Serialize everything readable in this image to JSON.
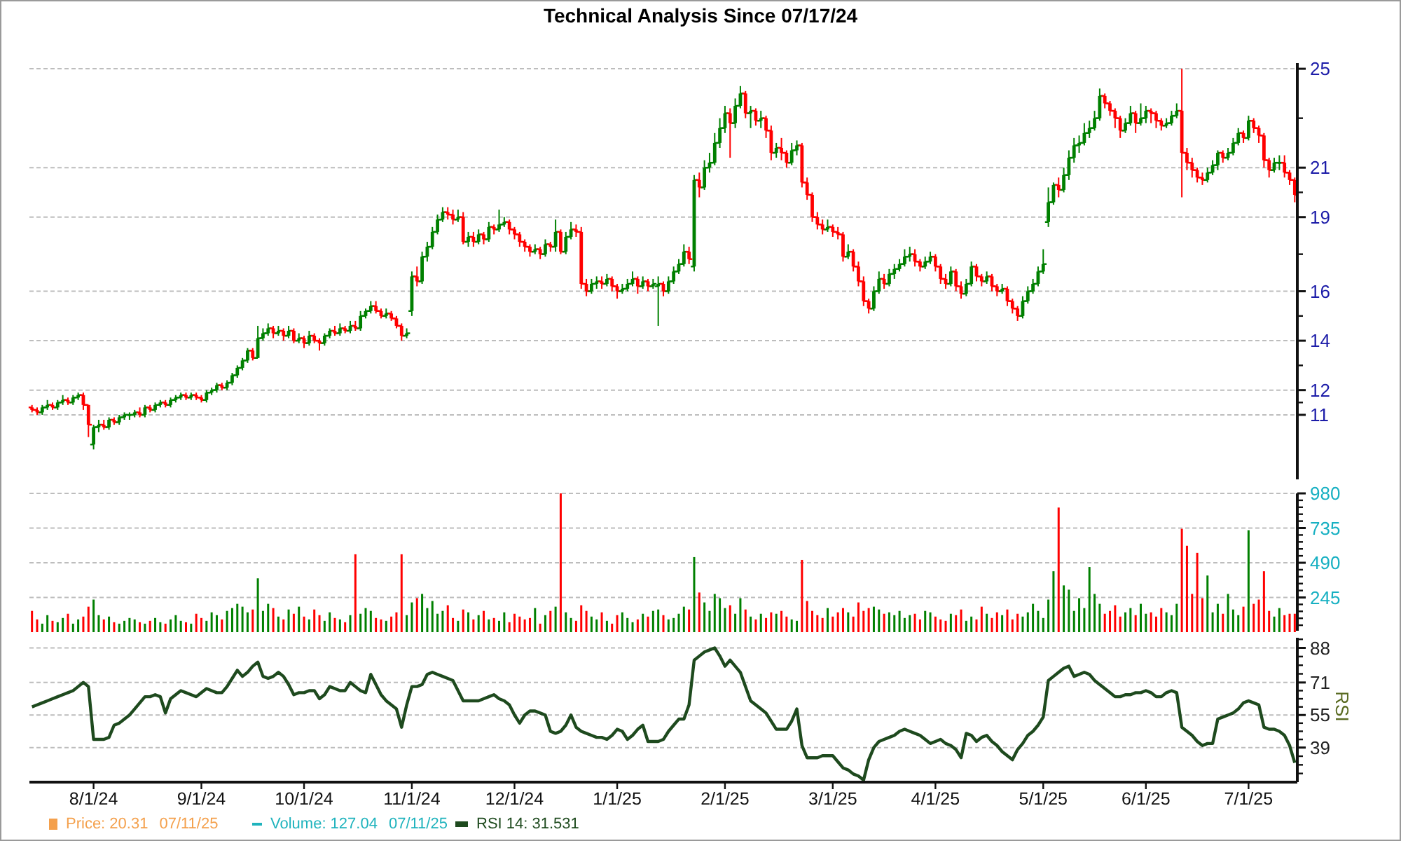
{
  "title": "Technical Analysis Since 07/17/24",
  "price_panel": {
    "chart_data": {
      "type": "candlestick",
      "grid": true,
      "ylim": [
        8.39,
        25.23
      ],
      "yticks": [
        25,
        21,
        19,
        16,
        14,
        12,
        11
      ],
      "categories": [
        null,
        null,
        null,
        null,
        null,
        null,
        null,
        null,
        null,
        null,
        null,
        null,
        null,
        null,
        null,
        null,
        null,
        null,
        null,
        null,
        null,
        null,
        null,
        null,
        null,
        null,
        null,
        null,
        null,
        null,
        null,
        null,
        null,
        null,
        null,
        null,
        null,
        null,
        null,
        null,
        null,
        null,
        null,
        null,
        null,
        null,
        null,
        null,
        null,
        null,
        null,
        null,
        null,
        null,
        null,
        null,
        null,
        null,
        null,
        null,
        null,
        null,
        null,
        null,
        null,
        null,
        null,
        null,
        null,
        null,
        null,
        null,
        null,
        null,
        null,
        null,
        null,
        null,
        null,
        null,
        null,
        null,
        null,
        null,
        null,
        null,
        null,
        null,
        null,
        null,
        null,
        null,
        null,
        null,
        null,
        null,
        null,
        null,
        null,
        null,
        null,
        null,
        null,
        null,
        null,
        null,
        null,
        null,
        null,
        null,
        null,
        null,
        null,
        null,
        null,
        null,
        null,
        null,
        null,
        null,
        null,
        null,
        null,
        null,
        null,
        null,
        null,
        null,
        null,
        null,
        null,
        null,
        null,
        null,
        null,
        null,
        null,
        null,
        null,
        null,
        null,
        null,
        null,
        null,
        null,
        null,
        null,
        null,
        null,
        null,
        null,
        null,
        null,
        null,
        null,
        null,
        null,
        null,
        null,
        null,
        null,
        null,
        null,
        null,
        null,
        null,
        null,
        null,
        null,
        null,
        null,
        null,
        null,
        null,
        null,
        null,
        null,
        null,
        null,
        null,
        null,
        null,
        null,
        null,
        null,
        null,
        null,
        null,
        null,
        null,
        null,
        null,
        null,
        null,
        null,
        null,
        null,
        null,
        null,
        null,
        null,
        null,
        null,
        null,
        null,
        null,
        null,
        null,
        null,
        null,
        null,
        null,
        null,
        null,
        null,
        null,
        null,
        null,
        null,
        null,
        null,
        null,
        null,
        null,
        null,
        null,
        null,
        null,
        null,
        null,
        null,
        null,
        null,
        null,
        null,
        null,
        null,
        null,
        null,
        null,
        null,
        null,
        null,
        null,
        null,
        null,
        null
      ],
      "ohlc": [
        [
          11.3,
          11.4,
          11.1,
          11.2
        ],
        [
          11.2,
          11.3,
          11.0,
          11.1
        ],
        [
          11.1,
          11.4,
          11.0,
          11.3
        ],
        [
          11.3,
          11.6,
          11.2,
          11.4
        ],
        [
          11.4,
          11.5,
          11.2,
          11.3
        ],
        [
          11.3,
          11.6,
          11.2,
          11.5
        ],
        [
          11.5,
          11.8,
          11.4,
          11.6
        ],
        [
          11.6,
          11.7,
          11.4,
          11.5
        ],
        [
          11.5,
          11.8,
          11.4,
          11.7
        ],
        [
          11.7,
          11.9,
          11.6,
          11.8
        ],
        [
          11.8,
          11.9,
          11.2,
          11.4
        ],
        [
          11.4,
          11.4,
          10.1,
          10.6
        ],
        [
          9.8,
          10.6,
          9.6,
          10.5
        ],
        [
          10.5,
          10.8,
          10.3,
          10.6
        ],
        [
          10.6,
          10.8,
          10.4,
          10.5
        ],
        [
          10.5,
          10.9,
          10.4,
          10.8
        ],
        [
          10.8,
          10.9,
          10.6,
          10.7
        ],
        [
          10.7,
          11.0,
          10.6,
          10.9
        ],
        [
          10.9,
          11.1,
          10.8,
          11.0
        ],
        [
          11.0,
          11.1,
          10.8,
          11.0
        ],
        [
          11.0,
          11.2,
          10.9,
          11.1
        ],
        [
          11.1,
          11.3,
          10.9,
          11.0
        ],
        [
          11.0,
          11.4,
          10.9,
          11.3
        ],
        [
          11.3,
          11.4,
          11.1,
          11.2
        ],
        [
          11.2,
          11.5,
          11.1,
          11.4
        ],
        [
          11.4,
          11.6,
          11.3,
          11.5
        ],
        [
          11.5,
          11.6,
          11.3,
          11.4
        ],
        [
          11.4,
          11.7,
          11.3,
          11.6
        ],
        [
          11.6,
          11.8,
          11.5,
          11.7
        ],
        [
          11.7,
          11.9,
          11.6,
          11.8
        ],
        [
          11.8,
          11.9,
          11.6,
          11.7
        ],
        [
          11.7,
          11.9,
          11.6,
          11.8
        ],
        [
          11.8,
          11.9,
          11.6,
          11.7
        ],
        [
          11.7,
          11.8,
          11.5,
          11.6
        ],
        [
          11.6,
          12.0,
          11.5,
          11.9
        ],
        [
          11.9,
          12.1,
          11.8,
          12.0
        ],
        [
          12.0,
          12.3,
          11.9,
          12.2
        ],
        [
          12.2,
          12.3,
          12.0,
          12.1
        ],
        [
          12.1,
          12.4,
          12.0,
          12.3
        ],
        [
          12.3,
          12.7,
          12.2,
          12.6
        ],
        [
          12.6,
          13.0,
          12.5,
          12.9
        ],
        [
          12.9,
          13.3,
          12.8,
          13.2
        ],
        [
          13.2,
          13.7,
          13.1,
          13.6
        ],
        [
          13.6,
          13.7,
          13.2,
          13.3
        ],
        [
          13.3,
          14.6,
          13.3,
          14.1
        ],
        [
          14.1,
          14.5,
          14.0,
          14.3
        ],
        [
          14.3,
          14.7,
          14.2,
          14.5
        ],
        [
          14.5,
          14.6,
          14.1,
          14.3
        ],
        [
          14.3,
          14.6,
          14.2,
          14.4
        ],
        [
          14.4,
          14.5,
          14.0,
          14.2
        ],
        [
          14.2,
          14.6,
          14.1,
          14.4
        ],
        [
          14.4,
          14.5,
          13.9,
          14.0
        ],
        [
          14.0,
          14.3,
          13.9,
          14.1
        ],
        [
          14.1,
          14.2,
          13.7,
          13.9
        ],
        [
          13.9,
          14.4,
          13.8,
          14.2
        ],
        [
          14.2,
          14.3,
          13.9,
          14.0
        ],
        [
          14.0,
          14.1,
          13.6,
          13.9
        ],
        [
          13.9,
          14.3,
          13.8,
          14.2
        ],
        [
          14.2,
          14.5,
          14.1,
          14.4
        ],
        [
          14.4,
          14.6,
          14.2,
          14.3
        ],
        [
          14.3,
          14.7,
          14.2,
          14.5
        ],
        [
          14.5,
          14.6,
          14.3,
          14.4
        ],
        [
          14.4,
          14.8,
          14.3,
          14.6
        ],
        [
          14.6,
          14.8,
          14.4,
          14.5
        ],
        [
          14.5,
          15.2,
          14.4,
          15.0
        ],
        [
          15.0,
          15.3,
          14.9,
          15.2
        ],
        [
          15.2,
          15.6,
          15.1,
          15.4
        ],
        [
          15.4,
          15.6,
          15.1,
          15.2
        ],
        [
          15.2,
          15.3,
          14.9,
          15.0
        ],
        [
          15.0,
          15.3,
          14.9,
          15.1
        ],
        [
          15.1,
          15.2,
          14.8,
          14.9
        ],
        [
          14.9,
          15.0,
          14.5,
          14.6
        ],
        [
          14.6,
          14.7,
          14.0,
          14.2
        ],
        [
          14.2,
          14.5,
          14.1,
          14.3
        ],
        [
          15.2,
          16.8,
          15.0,
          16.6
        ],
        [
          16.6,
          17.0,
          16.2,
          16.4
        ],
        [
          16.4,
          17.6,
          16.3,
          17.4
        ],
        [
          17.4,
          18.0,
          17.2,
          17.8
        ],
        [
          17.8,
          18.6,
          17.7,
          18.4
        ],
        [
          18.4,
          19.1,
          18.3,
          18.9
        ],
        [
          18.9,
          19.4,
          18.8,
          19.2
        ],
        [
          19.2,
          19.4,
          18.9,
          19.1
        ],
        [
          19.1,
          19.3,
          18.7,
          18.9
        ],
        [
          18.9,
          19.3,
          18.8,
          19.0
        ],
        [
          19.0,
          19.2,
          17.9,
          18.0
        ],
        [
          18.0,
          18.4,
          17.8,
          18.2
        ],
        [
          18.2,
          18.4,
          17.8,
          18.0
        ],
        [
          18.0,
          18.5,
          17.9,
          18.3
        ],
        [
          18.3,
          18.4,
          17.9,
          18.1
        ],
        [
          18.1,
          18.8,
          18.0,
          18.6
        ],
        [
          18.6,
          18.7,
          18.3,
          18.5
        ],
        [
          18.5,
          19.3,
          18.4,
          18.7
        ],
        [
          18.7,
          19.0,
          18.6,
          18.8
        ],
        [
          18.8,
          18.9,
          18.3,
          18.5
        ],
        [
          18.5,
          18.6,
          18.1,
          18.3
        ],
        [
          18.3,
          18.4,
          17.8,
          18.0
        ],
        [
          18.0,
          18.1,
          17.6,
          17.8
        ],
        [
          17.8,
          17.9,
          17.4,
          17.6
        ],
        [
          17.6,
          17.9,
          17.5,
          17.7
        ],
        [
          17.7,
          17.8,
          17.3,
          17.5
        ],
        [
          17.5,
          18.1,
          17.4,
          17.9
        ],
        [
          17.9,
          18.0,
          17.6,
          17.8
        ],
        [
          17.8,
          18.9,
          17.6,
          18.4
        ],
        [
          18.4,
          18.5,
          17.5,
          17.6
        ],
        [
          17.6,
          18.4,
          17.5,
          18.2
        ],
        [
          18.2,
          18.8,
          18.1,
          18.5
        ],
        [
          18.5,
          18.7,
          18.2,
          18.4
        ],
        [
          18.4,
          18.6,
          16.1,
          16.3
        ],
        [
          16.3,
          16.5,
          15.8,
          16.0
        ],
        [
          16.0,
          16.5,
          15.9,
          16.3
        ],
        [
          16.3,
          16.6,
          16.1,
          16.4
        ],
        [
          16.4,
          16.6,
          16.1,
          16.3
        ],
        [
          16.3,
          16.7,
          16.2,
          16.5
        ],
        [
          16.5,
          16.6,
          16.0,
          16.2
        ],
        [
          16.2,
          16.3,
          15.7,
          16.0
        ],
        [
          16.0,
          16.3,
          15.9,
          16.1
        ],
        [
          16.1,
          16.5,
          16.0,
          16.3
        ],
        [
          16.3,
          16.8,
          16.2,
          16.5
        ],
        [
          16.5,
          16.6,
          15.9,
          16.2
        ],
        [
          16.2,
          16.6,
          16.1,
          16.4
        ],
        [
          16.4,
          16.5,
          16.0,
          16.2
        ],
        [
          16.2,
          16.5,
          16.1,
          16.3
        ],
        [
          16.2,
          16.6,
          14.6,
          16.3
        ],
        [
          16.3,
          16.4,
          15.8,
          16.0
        ],
        [
          16.0,
          16.6,
          15.9,
          16.4
        ],
        [
          16.4,
          17.0,
          16.3,
          16.8
        ],
        [
          16.8,
          17.3,
          16.7,
          17.1
        ],
        [
          17.1,
          17.9,
          17.0,
          17.6
        ],
        [
          17.6,
          17.8,
          17.1,
          17.3
        ],
        [
          17.0,
          20.7,
          16.8,
          20.5
        ],
        [
          20.5,
          20.8,
          19.8,
          20.2
        ],
        [
          20.2,
          21.3,
          20.1,
          21.0
        ],
        [
          21.0,
          21.6,
          20.8,
          21.2
        ],
        [
          21.2,
          22.4,
          21.1,
          22.0
        ],
        [
          22.0,
          23.0,
          21.8,
          22.6
        ],
        [
          22.6,
          23.5,
          22.4,
          23.2
        ],
        [
          23.2,
          23.4,
          21.4,
          22.8
        ],
        [
          22.8,
          23.8,
          22.6,
          23.5
        ],
        [
          23.5,
          24.3,
          23.4,
          24.0
        ],
        [
          24.0,
          24.1,
          23.0,
          23.2
        ],
        [
          23.2,
          23.5,
          22.6,
          23.3
        ],
        [
          23.3,
          23.4,
          22.7,
          22.9
        ],
        [
          22.9,
          23.3,
          22.6,
          23.0
        ],
        [
          23.0,
          23.1,
          22.2,
          22.5
        ],
        [
          22.5,
          22.7,
          21.3,
          21.6
        ],
        [
          21.6,
          22.0,
          21.4,
          21.8
        ],
        [
          21.8,
          22.2,
          21.3,
          21.6
        ],
        [
          21.6,
          21.7,
          21.0,
          21.2
        ],
        [
          21.2,
          22.0,
          21.1,
          21.7
        ],
        [
          21.7,
          22.1,
          21.5,
          21.9
        ],
        [
          21.9,
          22.0,
          20.2,
          20.4
        ],
        [
          20.4,
          20.6,
          19.7,
          19.9
        ],
        [
          19.9,
          20.0,
          18.8,
          19.0
        ],
        [
          19.0,
          19.2,
          18.5,
          18.7
        ],
        [
          18.7,
          18.9,
          18.3,
          18.5
        ],
        [
          18.5,
          18.9,
          18.4,
          18.6
        ],
        [
          18.6,
          18.7,
          18.2,
          18.4
        ],
        [
          18.4,
          18.6,
          18.1,
          18.3
        ],
        [
          18.3,
          18.4,
          17.2,
          17.4
        ],
        [
          17.4,
          17.9,
          17.3,
          17.6
        ],
        [
          17.6,
          17.7,
          16.8,
          17.0
        ],
        [
          17.0,
          17.2,
          16.2,
          16.4
        ],
        [
          16.4,
          16.6,
          15.4,
          15.6
        ],
        [
          15.6,
          15.7,
          15.1,
          15.3
        ],
        [
          15.3,
          16.2,
          15.2,
          16.0
        ],
        [
          16.0,
          16.8,
          15.9,
          16.5
        ],
        [
          16.5,
          16.7,
          16.1,
          16.3
        ],
        [
          16.3,
          16.9,
          16.2,
          16.7
        ],
        [
          16.7,
          17.1,
          16.5,
          16.9
        ],
        [
          16.9,
          17.3,
          16.8,
          17.1
        ],
        [
          17.1,
          17.7,
          17.0,
          17.4
        ],
        [
          17.4,
          17.8,
          17.2,
          17.5
        ],
        [
          17.5,
          17.7,
          17.0,
          17.2
        ],
        [
          17.2,
          17.3,
          16.8,
          17.0
        ],
        [
          17.0,
          17.4,
          16.9,
          17.2
        ],
        [
          17.2,
          17.6,
          17.1,
          17.4
        ],
        [
          17.4,
          17.5,
          16.8,
          17.0
        ],
        [
          17.0,
          17.1,
          16.3,
          16.5
        ],
        [
          16.5,
          16.7,
          16.1,
          16.3
        ],
        [
          16.3,
          17.0,
          16.2,
          16.8
        ],
        [
          16.8,
          16.9,
          16.0,
          16.2
        ],
        [
          16.2,
          16.4,
          15.7,
          15.9
        ],
        [
          15.9,
          16.5,
          15.8,
          16.3
        ],
        [
          16.3,
          17.2,
          16.2,
          17.0
        ],
        [
          17.0,
          17.1,
          16.4,
          16.6
        ],
        [
          16.6,
          16.7,
          16.2,
          16.4
        ],
        [
          16.4,
          16.8,
          16.3,
          16.6
        ],
        [
          16.6,
          16.7,
          16.0,
          16.2
        ],
        [
          16.2,
          16.3,
          15.8,
          16.0
        ],
        [
          16.0,
          16.3,
          15.9,
          16.1
        ],
        [
          16.1,
          16.2,
          15.4,
          15.6
        ],
        [
          15.6,
          15.7,
          15.1,
          15.3
        ],
        [
          15.3,
          15.4,
          14.8,
          15.0
        ],
        [
          15.0,
          15.8,
          14.9,
          15.6
        ],
        [
          15.6,
          16.2,
          15.5,
          16.0
        ],
        [
          16.0,
          16.5,
          15.9,
          16.3
        ],
        [
          16.3,
          17.0,
          16.2,
          16.8
        ],
        [
          16.8,
          17.7,
          16.7,
          17.1
        ],
        [
          18.8,
          20.2,
          18.6,
          19.6
        ],
        [
          19.6,
          20.4,
          19.5,
          20.3
        ],
        [
          20.3,
          20.6,
          19.8,
          20.1
        ],
        [
          20.1,
          21.0,
          20.0,
          20.7
        ],
        [
          20.7,
          21.7,
          20.5,
          21.4
        ],
        [
          21.4,
          22.2,
          21.2,
          21.9
        ],
        [
          21.9,
          22.3,
          21.6,
          22.0
        ],
        [
          22.0,
          22.8,
          21.9,
          22.4
        ],
        [
          22.4,
          22.9,
          22.2,
          22.6
        ],
        [
          22.6,
          23.3,
          22.5,
          23.0
        ],
        [
          23.0,
          24.2,
          22.9,
          23.9
        ],
        [
          23.9,
          24.0,
          23.4,
          23.6
        ],
        [
          23.6,
          23.7,
          23.1,
          23.3
        ],
        [
          23.3,
          23.4,
          22.6,
          23.0
        ],
        [
          23.0,
          23.1,
          22.2,
          22.5
        ],
        [
          22.5,
          23.0,
          22.4,
          22.8
        ],
        [
          22.8,
          23.5,
          22.7,
          23.2
        ],
        [
          23.2,
          23.3,
          22.4,
          22.8
        ],
        [
          22.8,
          23.6,
          22.7,
          23.0
        ],
        [
          23.0,
          23.5,
          22.8,
          23.3
        ],
        [
          23.3,
          23.4,
          22.8,
          23.2
        ],
        [
          23.2,
          23.3,
          22.6,
          22.9
        ],
        [
          22.9,
          23.0,
          22.5,
          22.7
        ],
        [
          22.7,
          23.0,
          22.6,
          22.8
        ],
        [
          22.8,
          23.3,
          22.7,
          23.1
        ],
        [
          23.1,
          23.6,
          23.0,
          23.3
        ],
        [
          23.3,
          25.0,
          19.8,
          21.6
        ],
        [
          21.6,
          21.8,
          20.9,
          21.2
        ],
        [
          21.2,
          21.4,
          20.6,
          20.9
        ],
        [
          20.9,
          21.0,
          20.4,
          20.6
        ],
        [
          20.6,
          20.8,
          20.3,
          20.5
        ],
        [
          20.5,
          21.0,
          20.4,
          20.8
        ],
        [
          20.8,
          21.3,
          20.7,
          21.1
        ],
        [
          21.1,
          21.7,
          20.9,
          21.6
        ],
        [
          21.6,
          21.7,
          21.2,
          21.4
        ],
        [
          21.4,
          21.8,
          21.3,
          21.6
        ],
        [
          21.6,
          22.2,
          21.5,
          22.0
        ],
        [
          22.0,
          22.6,
          21.9,
          22.4
        ],
        [
          22.4,
          22.5,
          22.0,
          22.2
        ],
        [
          22.2,
          23.1,
          22.1,
          22.9
        ],
        [
          22.9,
          23.0,
          22.4,
          22.6
        ],
        [
          22.6,
          22.7,
          22.0,
          22.3
        ],
        [
          22.3,
          22.4,
          21.0,
          21.3
        ],
        [
          21.3,
          21.4,
          20.6,
          20.9
        ],
        [
          20.9,
          21.4,
          20.8,
          21.2
        ],
        [
          21.2,
          21.5,
          20.9,
          21.2
        ],
        [
          21.2,
          21.5,
          20.6,
          20.8
        ],
        [
          20.8,
          20.9,
          20.3,
          20.5
        ],
        [
          20.5,
          20.6,
          19.6,
          19.9
        ]
      ]
    }
  },
  "volume_panel": {
    "chart_data": {
      "type": "bar",
      "grid": true,
      "ylim": [
        0,
        980
      ],
      "yticks": [
        245,
        490,
        735,
        980
      ],
      "categories": [
        null,
        null,
        null,
        null,
        null,
        null,
        null,
        null,
        null,
        null,
        null,
        null,
        null,
        null,
        null,
        null,
        null,
        null,
        null,
        null,
        null,
        null,
        null,
        null,
        null,
        null,
        null,
        null,
        null,
        null,
        null,
        null,
        null,
        null,
        null,
        null,
        null,
        null,
        null,
        null,
        null,
        null,
        null,
        null,
        null,
        null,
        null,
        null,
        null,
        null,
        null,
        null,
        null,
        null,
        null,
        null,
        null,
        null,
        null,
        null,
        null,
        null,
        null,
        null,
        null,
        null,
        null,
        null,
        null,
        null,
        null,
        null,
        null,
        null,
        null,
        null,
        null,
        null,
        null,
        null,
        null,
        null,
        null,
        null,
        null,
        null,
        null,
        null,
        null,
        null,
        null,
        null,
        null,
        null,
        null,
        null,
        null,
        null,
        null,
        null,
        null,
        null,
        null,
        null,
        null,
        null,
        null,
        null,
        null,
        null,
        null,
        null,
        null,
        null,
        null,
        null,
        null,
        null,
        null,
        null,
        null,
        null,
        null,
        null,
        null,
        null,
        null,
        null,
        null,
        null,
        null,
        null,
        null,
        null,
        null,
        null,
        null,
        null,
        null,
        null,
        null,
        null,
        null,
        null,
        null,
        null,
        null,
        null,
        null,
        null,
        null,
        null,
        null,
        null,
        null,
        null,
        null,
        null,
        null,
        null,
        null,
        null,
        null,
        null,
        null,
        null,
        null,
        null,
        null,
        null,
        null,
        null,
        null,
        null,
        null,
        null,
        null,
        null,
        null,
        null,
        null,
        null,
        null,
        null,
        null,
        null,
        null,
        null,
        null,
        null,
        null,
        null,
        null,
        null,
        null,
        null,
        null,
        null,
        null,
        null,
        null,
        null,
        null,
        null,
        null,
        null,
        null,
        null,
        null,
        null,
        null,
        null,
        null,
        null,
        null,
        null,
        null,
        null,
        null,
        null,
        null,
        null,
        null,
        null,
        null,
        null,
        null,
        null,
        null,
        null,
        null,
        null,
        null,
        null,
        null,
        null,
        null,
        null,
        null,
        null,
        null,
        null,
        null,
        null,
        null,
        null,
        null
      ],
      "values": [
        150,
        90,
        60,
        120,
        80,
        70,
        100,
        130,
        60,
        90,
        110,
        180,
        230,
        120,
        90,
        110,
        70,
        60,
        80,
        100,
        90,
        70,
        60,
        80,
        100,
        70,
        60,
        90,
        120,
        80,
        70,
        60,
        130,
        100,
        80,
        140,
        120,
        90,
        150,
        170,
        200,
        180,
        140,
        160,
        380,
        150,
        200,
        170,
        110,
        90,
        160,
        130,
        180,
        110,
        90,
        160,
        120,
        80,
        140,
        100,
        90,
        70,
        120,
        550,
        130,
        170,
        150,
        100,
        90,
        80,
        110,
        140,
        550,
        120,
        210,
        240,
        270,
        170,
        220,
        130,
        150,
        190,
        100,
        80,
        160,
        140,
        90,
        120,
        150,
        90,
        100,
        80,
        140,
        70,
        130,
        110,
        90,
        100,
        170,
        60,
        120,
        150,
        180,
        980,
        140,
        100,
        80,
        190,
        150,
        110,
        90,
        140,
        80,
        60,
        120,
        140,
        100,
        70,
        90,
        130,
        110,
        150,
        160,
        120,
        90,
        100,
        130,
        180,
        160,
        530,
        280,
        210,
        150,
        270,
        240,
        170,
        190,
        130,
        240,
        160,
        110,
        90,
        130,
        100,
        140,
        130,
        150,
        110,
        90,
        80,
        510,
        220,
        150,
        120,
        100,
        170,
        110,
        140,
        170,
        140,
        110,
        210,
        150,
        170,
        180,
        160,
        130,
        140,
        120,
        150,
        100,
        120,
        130,
        90,
        150,
        140,
        110,
        90,
        80,
        130,
        120,
        160,
        80,
        110,
        90,
        180,
        130,
        100,
        140,
        120,
        160,
        90,
        130,
        110,
        140,
        200,
        150,
        100,
        230,
        430,
        880,
        330,
        300,
        150,
        240,
        170,
        460,
        270,
        200,
        130,
        150,
        190,
        110,
        140,
        170,
        120,
        200,
        130,
        140,
        110,
        170,
        140,
        120,
        200,
        730,
        610,
        270,
        560,
        240,
        400,
        140,
        200,
        130,
        270,
        160,
        120,
        180,
        720,
        200,
        230,
        430,
        150,
        110,
        170,
        120,
        130,
        130
      ]
    }
  },
  "rsi_panel": {
    "chart_data": {
      "type": "line",
      "grid": true,
      "ylabel": "RSI",
      "ylim": [
        22,
        93
      ],
      "yticks": [
        88,
        71,
        55,
        39
      ],
      "categories": [
        null,
        null,
        null,
        null,
        null,
        null,
        null,
        null,
        null,
        null,
        null,
        null,
        "8/1/24",
        null,
        null,
        null,
        null,
        null,
        null,
        null,
        null,
        null,
        null,
        null,
        null,
        null,
        null,
        null,
        null,
        null,
        null,
        null,
        null,
        "9/1/24",
        null,
        null,
        null,
        null,
        null,
        null,
        null,
        null,
        null,
        null,
        null,
        null,
        null,
        null,
        null,
        null,
        null,
        null,
        null,
        "10/1/24",
        null,
        null,
        null,
        null,
        null,
        null,
        null,
        null,
        null,
        null,
        null,
        null,
        null,
        null,
        null,
        null,
        null,
        null,
        null,
        null,
        "11/1/24",
        null,
        null,
        null,
        null,
        null,
        null,
        null,
        null,
        null,
        null,
        null,
        null,
        null,
        null,
        null,
        null,
        null,
        null,
        null,
        "12/1/24",
        null,
        null,
        null,
        null,
        null,
        null,
        null,
        null,
        null,
        null,
        null,
        null,
        null,
        null,
        null,
        null,
        null,
        null,
        null,
        "1/1/25",
        null,
        null,
        null,
        null,
        null,
        null,
        null,
        null,
        null,
        null,
        null,
        null,
        null,
        null,
        null,
        null,
        null,
        null,
        null,
        null,
        "2/1/25",
        null,
        null,
        null,
        null,
        null,
        null,
        null,
        null,
        null,
        null,
        null,
        null,
        null,
        null,
        null,
        null,
        null,
        null,
        null,
        null,
        "3/1/25",
        null,
        null,
        null,
        null,
        null,
        null,
        null,
        null,
        null,
        null,
        null,
        null,
        null,
        null,
        null,
        null,
        null,
        null,
        null,
        "4/1/25",
        null,
        null,
        null,
        null,
        null,
        null,
        null,
        null,
        null,
        null,
        null,
        null,
        null,
        null,
        null,
        null,
        null,
        null,
        null,
        null,
        "5/1/25",
        null,
        null,
        null,
        null,
        null,
        null,
        null,
        null,
        null,
        null,
        null,
        null,
        null,
        null,
        null,
        null,
        null,
        null,
        null,
        "6/1/25",
        null,
        null,
        null,
        null,
        null,
        null,
        null,
        null,
        null,
        null,
        null,
        null,
        null,
        null,
        null,
        null,
        null,
        null,
        null,
        "7/1/25",
        null,
        null,
        null,
        null,
        null,
        null,
        null,
        null,
        null
      ],
      "series": [
        {
          "color": "#1e4a1e",
          "values": [
            59,
            60,
            61,
            62,
            63,
            64,
            65,
            66,
            67,
            69,
            71,
            69,
            43,
            43,
            43,
            44,
            50,
            51,
            53,
            55,
            58,
            61,
            64,
            64,
            65,
            64,
            56,
            63,
            65,
            67,
            66,
            65,
            64,
            66,
            68,
            67,
            66,
            66,
            69,
            73,
            77,
            74,
            76,
            79,
            81,
            74,
            73,
            74,
            76,
            74,
            70,
            65,
            66,
            66,
            67,
            67,
            63,
            65,
            69,
            68,
            67,
            67,
            71,
            69,
            67,
            66,
            75,
            70,
            65,
            62,
            60,
            58,
            49,
            60,
            69,
            69,
            70,
            75,
            76,
            75,
            74,
            73,
            72,
            67,
            62,
            62,
            62,
            62,
            63,
            64,
            65,
            63,
            62,
            60,
            55,
            51,
            55,
            57,
            57,
            56,
            55,
            47,
            46,
            47,
            50,
            55,
            49,
            47,
            46,
            45,
            44,
            44,
            43,
            45,
            48,
            47,
            43,
            45,
            48,
            50,
            42,
            42,
            42,
            43,
            47,
            50,
            53,
            53,
            60,
            82,
            84,
            86,
            87,
            88,
            84,
            79,
            82,
            79,
            76,
            69,
            62,
            60,
            58,
            56,
            52,
            48,
            48,
            48,
            52,
            58,
            40,
            34,
            34,
            34,
            35,
            35,
            35,
            32,
            29,
            28,
            26,
            25,
            23,
            33,
            39,
            42,
            43,
            44,
            45,
            47,
            48,
            47,
            46,
            45,
            43,
            41,
            42,
            43,
            41,
            40,
            38,
            34,
            46,
            45,
            42,
            44,
            45,
            42,
            40,
            37,
            35,
            33,
            38,
            41,
            45,
            47,
            50,
            54,
            72,
            74,
            76,
            78,
            79,
            74,
            75,
            76,
            75,
            72,
            70,
            68,
            66,
            64,
            64,
            65,
            65,
            66,
            66,
            67,
            66,
            64,
            64,
            66,
            67,
            66,
            49,
            47,
            45,
            42,
            40,
            41,
            41,
            53,
            54,
            55,
            56,
            58,
            61,
            62,
            61,
            60,
            49,
            48,
            48,
            47,
            45,
            40,
            31.5
          ]
        }
      ]
    }
  },
  "legend": [
    {
      "kind": "square",
      "color": "#f4a04c",
      "label": "Price: 20.31",
      "date": "07/11/25"
    },
    {
      "kind": "dash",
      "color": "#1fb3bd",
      "label": "Volume: 127.04",
      "date": "07/11/25"
    },
    {
      "kind": "stroke",
      "color": "#1e4a1e",
      "label": "RSI 14: 31.531"
    }
  ]
}
